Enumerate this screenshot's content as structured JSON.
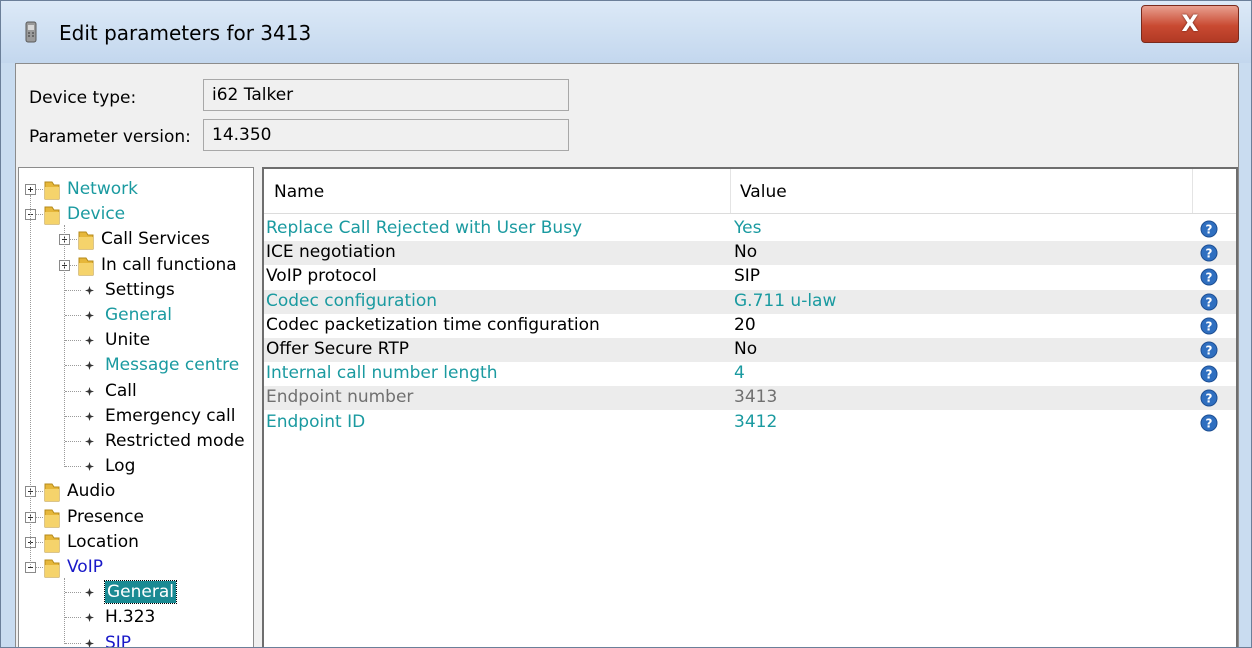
{
  "window": {
    "title": "Edit parameters for 3413",
    "close_label": "X"
  },
  "fields": {
    "device_type_label": "Device type:",
    "device_type_value": "i62 Talker",
    "param_version_label": "Parameter version:",
    "param_version_value": "14.350"
  },
  "tree": {
    "items": [
      {
        "label": "Network",
        "kind": "folder",
        "expanded": false,
        "level": 0,
        "color": "teal"
      },
      {
        "label": "Device",
        "kind": "folder",
        "expanded": true,
        "level": 0,
        "color": "teal"
      },
      {
        "label": "Call Services",
        "kind": "folder",
        "expanded": false,
        "level": 1,
        "color": "black"
      },
      {
        "label": "In call functiona",
        "kind": "folder",
        "expanded": false,
        "level": 1,
        "color": "black"
      },
      {
        "label": "Settings",
        "kind": "leaf",
        "level": 1,
        "color": "black"
      },
      {
        "label": "General",
        "kind": "leaf",
        "level": 1,
        "color": "teal"
      },
      {
        "label": "Unite",
        "kind": "leaf",
        "level": 1,
        "color": "black"
      },
      {
        "label": "Message centre",
        "kind": "leaf",
        "level": 1,
        "color": "teal"
      },
      {
        "label": "Call",
        "kind": "leaf",
        "level": 1,
        "color": "black"
      },
      {
        "label": "Emergency call",
        "kind": "leaf",
        "level": 1,
        "color": "black"
      },
      {
        "label": "Restricted mode",
        "kind": "leaf",
        "level": 1,
        "color": "black"
      },
      {
        "label": "Log",
        "kind": "leaf",
        "level": 1,
        "color": "black"
      },
      {
        "label": "Audio",
        "kind": "folder",
        "expanded": false,
        "level": 0,
        "color": "black"
      },
      {
        "label": "Presence",
        "kind": "folder",
        "expanded": false,
        "level": 0,
        "color": "black"
      },
      {
        "label": "Location",
        "kind": "folder",
        "expanded": false,
        "level": 0,
        "color": "black"
      },
      {
        "label": "VoIP",
        "kind": "folder",
        "expanded": true,
        "level": 0,
        "color": "blue"
      },
      {
        "label": "General",
        "kind": "leaf",
        "level": 1,
        "color": "white",
        "selected": true
      },
      {
        "label": "H.323",
        "kind": "leaf",
        "level": 1,
        "color": "black"
      },
      {
        "label": "SIP",
        "kind": "leaf",
        "level": 1,
        "color": "blue"
      }
    ]
  },
  "table": {
    "col_name": "Name",
    "col_value": "Value",
    "rows": [
      {
        "name": "Replace Call Rejected with User Busy",
        "value": "Yes",
        "color": "teal"
      },
      {
        "name": "ICE negotiation",
        "value": "No",
        "color": "black"
      },
      {
        "name": "VoIP protocol",
        "value": "SIP",
        "color": "black"
      },
      {
        "name": "Codec configuration",
        "value": "G.711 u-law",
        "color": "teal"
      },
      {
        "name": "Codec packetization time configuration",
        "value": "20",
        "color": "black"
      },
      {
        "name": "Offer Secure RTP",
        "value": "No",
        "color": "black"
      },
      {
        "name": "Internal call number length",
        "value": "4",
        "color": "teal"
      },
      {
        "name": "Endpoint number",
        "value": "3413",
        "color": "gray"
      },
      {
        "name": "Endpoint ID",
        "value": "3412",
        "color": "teal"
      }
    ]
  },
  "colors": {
    "teal": "#1a9aa0",
    "blue": "#1919c8",
    "selected_bg": "#1a8a93",
    "help_icon": "#2f6fc0"
  }
}
